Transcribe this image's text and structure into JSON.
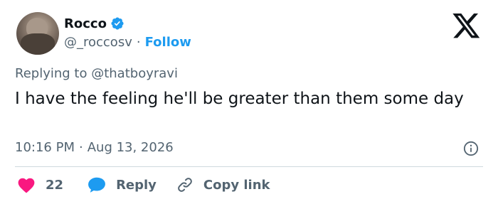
{
  "author": {
    "name": "Rocco",
    "handle": "@_roccosv",
    "separator": "·",
    "follow_label": "Follow"
  },
  "reply_context": {
    "prefix": "Replying to",
    "mention": "@thatboyravi"
  },
  "tweet": {
    "text": "I have the feeling he'll be greater than them some day",
    "time": "10:16 PM",
    "separator": "·",
    "date": "Aug 13, 2026"
  },
  "actions": {
    "likes_count": "22",
    "reply_label": "Reply",
    "copy_label": "Copy link"
  },
  "colors": {
    "accent": "#1d9bf0",
    "like": "#f91880",
    "secondary_text": "#536471",
    "divider": "#cfd9de"
  },
  "icons": [
    "verified-badge-icon",
    "x-logo-icon",
    "info-icon",
    "heart-icon",
    "speech-bubble-icon",
    "link-icon"
  ]
}
